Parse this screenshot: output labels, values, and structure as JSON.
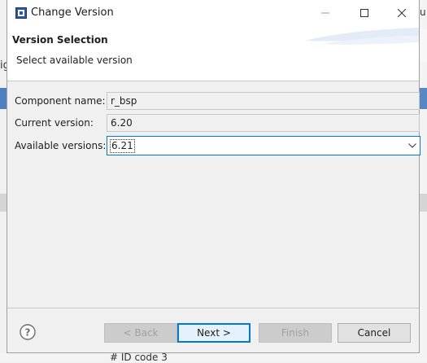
{
  "window": {
    "title": "Change Version"
  },
  "banner": {
    "title": "Version Selection",
    "description": "Select available version"
  },
  "form": {
    "component_label": "Component name:",
    "component_value": "r_bsp",
    "current_label": "Current version:",
    "current_value": "6.20",
    "available_label": "Available versions:",
    "available_value": "6.21"
  },
  "buttons": {
    "back": "< Back",
    "next": "Next >",
    "finish": "Finish",
    "cancel": "Cancel"
  },
  "background": {
    "right_fragment": "u",
    "left_fragment": "ig",
    "bottom_fragment": "# ID code 3"
  },
  "colors": {
    "accent": "#0078d7",
    "bg_app_blue": "#5b86c4"
  }
}
